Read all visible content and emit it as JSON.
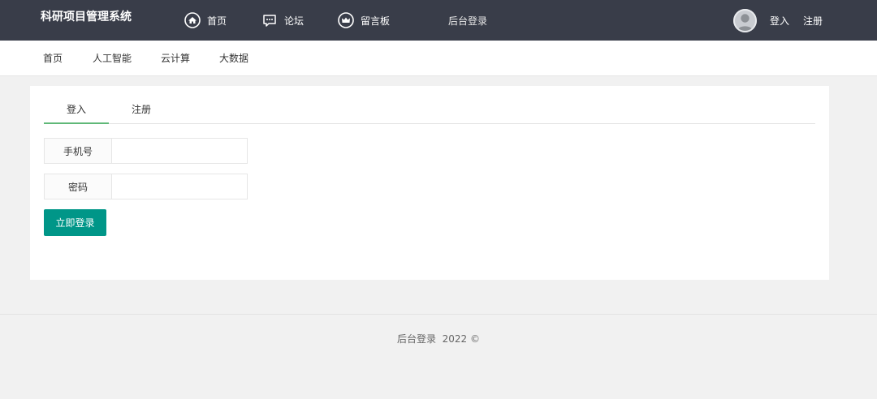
{
  "header": {
    "brand": "科研项目管理系统",
    "nav": [
      {
        "label": "首页",
        "icon": "home-icon"
      },
      {
        "label": "论坛",
        "icon": "chat-icon"
      },
      {
        "label": "留言板",
        "icon": "crown-icon"
      },
      {
        "label": "后台登录"
      }
    ],
    "user": {
      "login": "登入",
      "register": "注册",
      "avatar_icon": "avatar-icon"
    }
  },
  "subnav": [
    "首页",
    "人工智能",
    "云计算",
    "大数据"
  ],
  "tabs": {
    "login": "登入",
    "register": "注册"
  },
  "form": {
    "phone_label": "手机号",
    "phone_value": "",
    "password_label": "密码",
    "password_value": "",
    "submit_label": "立即登录"
  },
  "footer": {
    "text": "后台登录  2022 ©"
  },
  "colors": {
    "topbar": "#393d49",
    "button": "#009688",
    "tab_active": "#5fb878"
  }
}
